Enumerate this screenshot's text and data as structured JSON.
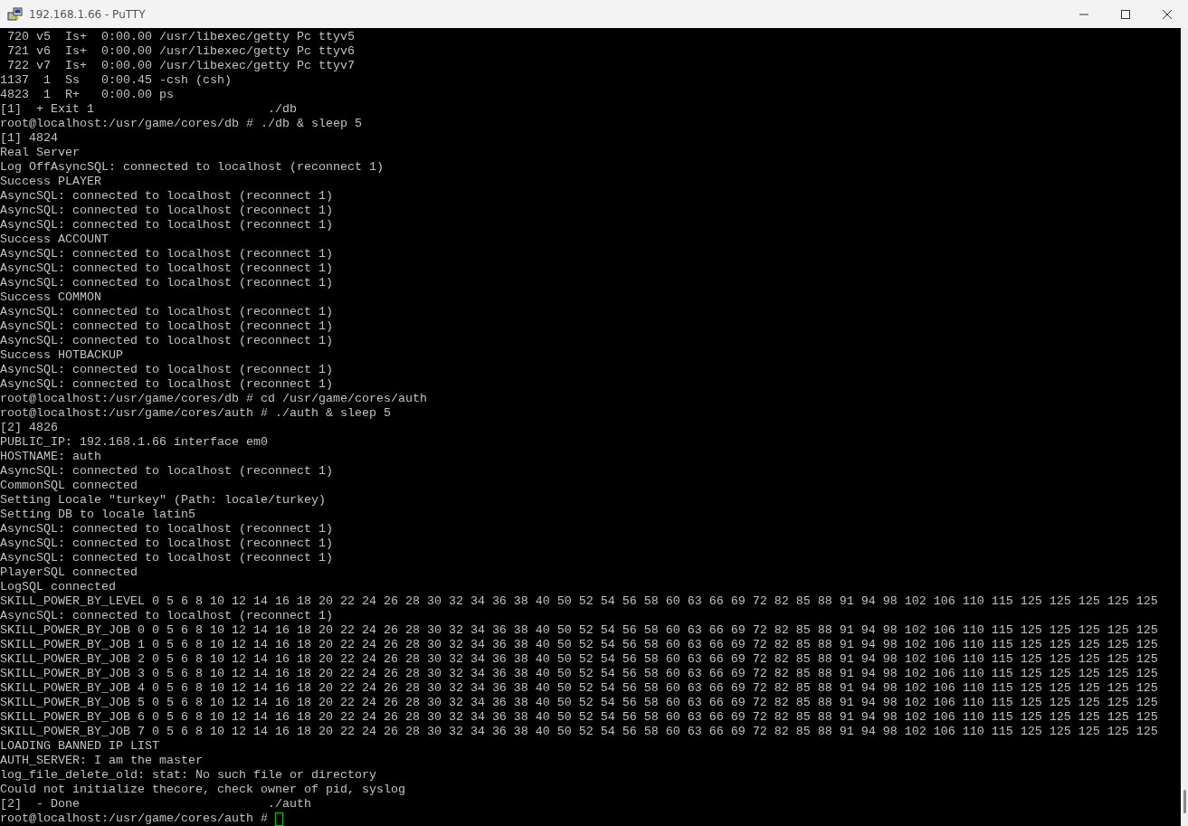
{
  "window": {
    "title": "192.168.1.66 - PuTTY"
  },
  "terminal": {
    "lines": [
      " 720 v5  Is+  0:00.00 /usr/libexec/getty Pc ttyv5",
      " 721 v6  Is+  0:00.00 /usr/libexec/getty Pc ttyv6",
      " 722 v7  Is+  0:00.00 /usr/libexec/getty Pc ttyv7",
      "1137  1  Ss   0:00.45 -csh (csh)",
      "4823  1  R+   0:00.00 ps",
      "[1]  + Exit 1                        ./db",
      "root@localhost:/usr/game/cores/db # ./db & sleep 5",
      "[1] 4824",
      "Real Server",
      "Log OffAsyncSQL: connected to localhost (reconnect 1)",
      "Success PLAYER",
      "AsyncSQL: connected to localhost (reconnect 1)",
      "AsyncSQL: connected to localhost (reconnect 1)",
      "AsyncSQL: connected to localhost (reconnect 1)",
      "Success ACCOUNT",
      "AsyncSQL: connected to localhost (reconnect 1)",
      "AsyncSQL: connected to localhost (reconnect 1)",
      "AsyncSQL: connected to localhost (reconnect 1)",
      "Success COMMON",
      "AsyncSQL: connected to localhost (reconnect 1)",
      "AsyncSQL: connected to localhost (reconnect 1)",
      "AsyncSQL: connected to localhost (reconnect 1)",
      "Success HOTBACKUP",
      "AsyncSQL: connected to localhost (reconnect 1)",
      "AsyncSQL: connected to localhost (reconnect 1)",
      "root@localhost:/usr/game/cores/db # cd /usr/game/cores/auth",
      "root@localhost:/usr/game/cores/auth # ./auth & sleep 5",
      "[2] 4826",
      "PUBLIC_IP: 192.168.1.66 interface em0",
      "HOSTNAME: auth",
      "AsyncSQL: connected to localhost (reconnect 1)",
      "CommonSQL connected",
      "Setting Locale \"turkey\" (Path: locale/turkey)",
      "Setting DB to locale latin5",
      "AsyncSQL: connected to localhost (reconnect 1)",
      "AsyncSQL: connected to localhost (reconnect 1)",
      "AsyncSQL: connected to localhost (reconnect 1)",
      "PlayerSQL connected",
      "LogSQL connected",
      "SKILL_POWER_BY_LEVEL 0 5 6 8 10 12 14 16 18 20 22 24 26 28 30 32 34 36 38 40 50 52 54 56 58 60 63 66 69 72 82 85 88 91 94 98 102 106 110 115 125 125 125 125 125",
      "AsyncSQL: connected to localhost (reconnect 1)",
      "SKILL_POWER_BY_JOB 0 0 5 6 8 10 12 14 16 18 20 22 24 26 28 30 32 34 36 38 40 50 52 54 56 58 60 63 66 69 72 82 85 88 91 94 98 102 106 110 115 125 125 125 125 125",
      "SKILL_POWER_BY_JOB 1 0 5 6 8 10 12 14 16 18 20 22 24 26 28 30 32 34 36 38 40 50 52 54 56 58 60 63 66 69 72 82 85 88 91 94 98 102 106 110 115 125 125 125 125 125",
      "SKILL_POWER_BY_JOB 2 0 5 6 8 10 12 14 16 18 20 22 24 26 28 30 32 34 36 38 40 50 52 54 56 58 60 63 66 69 72 82 85 88 91 94 98 102 106 110 115 125 125 125 125 125",
      "SKILL_POWER_BY_JOB 3 0 5 6 8 10 12 14 16 18 20 22 24 26 28 30 32 34 36 38 40 50 52 54 56 58 60 63 66 69 72 82 85 88 91 94 98 102 106 110 115 125 125 125 125 125",
      "SKILL_POWER_BY_JOB 4 0 5 6 8 10 12 14 16 18 20 22 24 26 28 30 32 34 36 38 40 50 52 54 56 58 60 63 66 69 72 82 85 88 91 94 98 102 106 110 115 125 125 125 125 125",
      "SKILL_POWER_BY_JOB 5 0 5 6 8 10 12 14 16 18 20 22 24 26 28 30 32 34 36 38 40 50 52 54 56 58 60 63 66 69 72 82 85 88 91 94 98 102 106 110 115 125 125 125 125 125",
      "SKILL_POWER_BY_JOB 6 0 5 6 8 10 12 14 16 18 20 22 24 26 28 30 32 34 36 38 40 50 52 54 56 58 60 63 66 69 72 82 85 88 91 94 98 102 106 110 115 125 125 125 125 125",
      "SKILL_POWER_BY_JOB 7 0 5 6 8 10 12 14 16 18 20 22 24 26 28 30 32 34 36 38 40 50 52 54 56 58 60 63 66 69 72 82 85 88 91 94 98 102 106 110 115 125 125 125 125 125",
      "LOADING BANNED IP LIST",
      "AUTH_SERVER: I am the master",
      "log_file_delete_old: stat: No such file or directory",
      "Could not initialize thecore, check owner of pid, syslog",
      "[2]  - Done                          ./auth"
    ],
    "prompt": "root@localhost:/usr/game/cores/auth #"
  }
}
